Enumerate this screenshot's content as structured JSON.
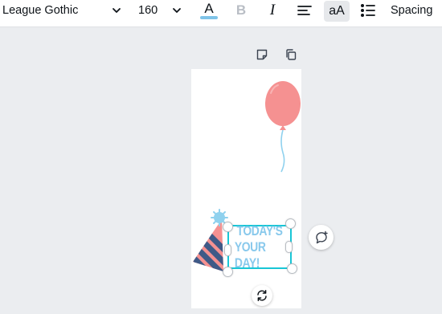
{
  "toolbar": {
    "font_family": "League Gothic",
    "font_size": "160",
    "text_color_label": "A",
    "text_color": "#7fc4e8",
    "bold_label": "B",
    "italic_label": "I",
    "case_label": "aA",
    "spacing_label": "Spacing"
  },
  "canvas": {
    "background": "#ffffff",
    "balloon_color": "#f59191",
    "hat_colors": [
      "#f59191",
      "#3f5a87",
      "#8fd1ee"
    ]
  },
  "selection": {
    "line1": "TODAY'S",
    "line2": "YOUR DAY!",
    "text_color": "#89c9ec",
    "border_color": "#19c6d6"
  }
}
